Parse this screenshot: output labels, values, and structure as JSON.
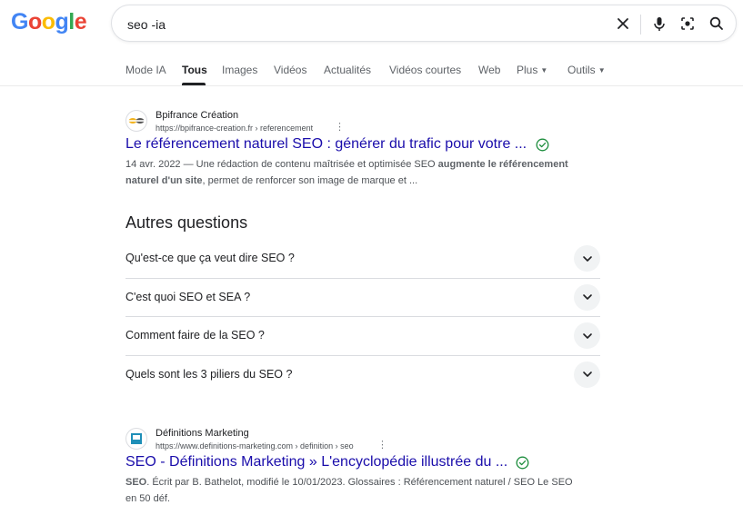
{
  "logo": {
    "text": "Google",
    "letters": [
      "G",
      "o",
      "o",
      "g",
      "l",
      "e"
    ],
    "colors": [
      "#4285F4",
      "#EA4335",
      "#FBBC05",
      "#4285F4",
      "#34A853",
      "#EA4335"
    ]
  },
  "search": {
    "query": "seo -ia",
    "icons": [
      "close-icon",
      "mic-icon",
      "lens-icon",
      "search-icon"
    ]
  },
  "tabs": [
    {
      "label": "Mode IA"
    },
    {
      "label": "Tous",
      "active": true
    },
    {
      "label": "Images"
    },
    {
      "label": "Vidéos"
    },
    {
      "label": "Actualités"
    },
    {
      "label": "Vidéos courtes"
    },
    {
      "label": "Web"
    },
    {
      "label": "Plus",
      "dropdown": true
    },
    {
      "label": "Outils",
      "dropdown": true
    }
  ],
  "results": [
    {
      "site_name": "Bpifrance Création",
      "url": "https://bpifrance-creation.fr › referencement",
      "title": "Le référencement naturel SEO : générer du trafic pour votre ...",
      "verified": true,
      "snippet_parts": {
        "date": "14 avr. 2022",
        "text1": " — Une rédaction de contenu maîtrisée et optimisée SEO ",
        "bold1": "augmente le référencement naturel d'un site",
        "text2": ", permet de renforcer son image de marque et ..."
      }
    },
    {
      "site_name": "Définitions Marketing",
      "url": "https://www.definitions-marketing.com › definition › seo",
      "title": "SEO - Définitions Marketing » L'encyclopédie illustrée du ...",
      "verified": true,
      "snippet_parts": {
        "bold1": "SEO",
        "text1": ". Écrit par B. Bathelot, modifié le 10/01/2023. Glossaires : Référencement naturel / SEO Le SEO en 50 déf."
      }
    }
  ],
  "paa": {
    "title": "Autres questions",
    "questions": [
      "Qu'est-ce que ça veut dire SEO ?",
      "C'est quoi SEO et SEA ?",
      "Comment faire de la SEO ?",
      "Quels sont les 3 piliers du SEO ?"
    ]
  },
  "colors": {
    "link": "#1a0dab",
    "verified": "#1e8e3e"
  }
}
